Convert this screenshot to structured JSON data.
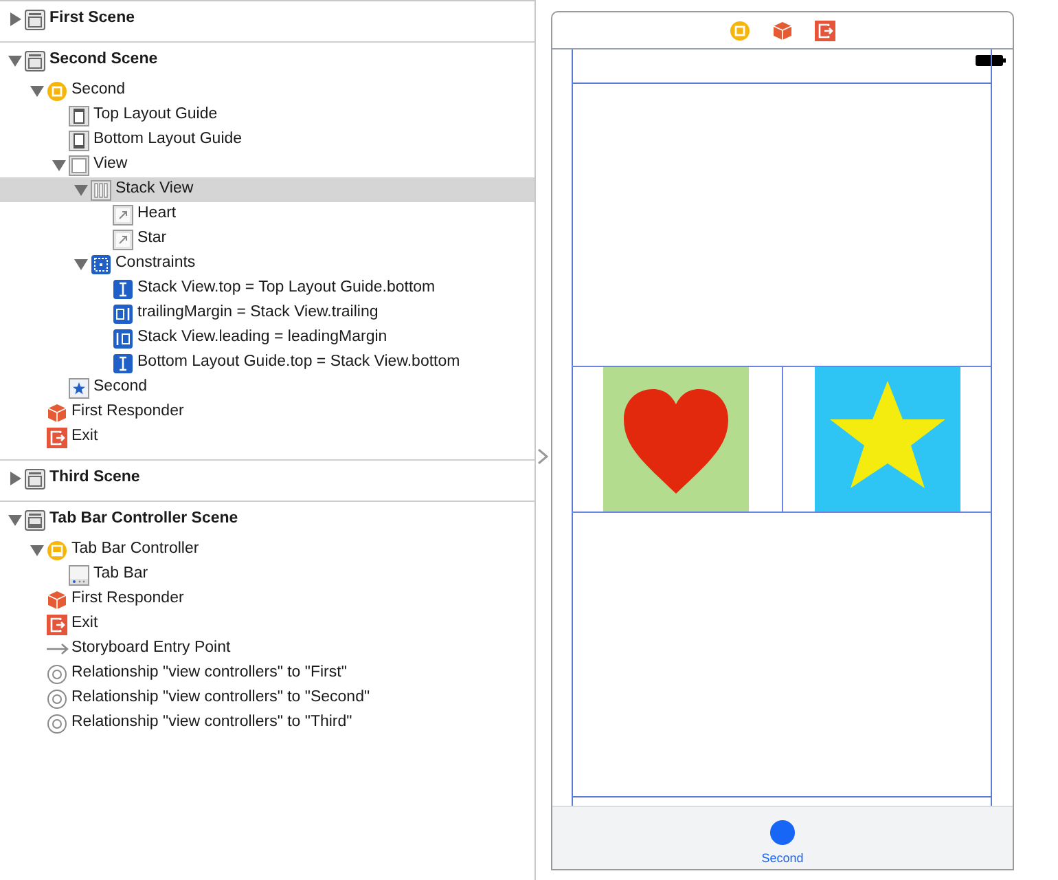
{
  "outline": {
    "scenes": [
      {
        "title": "First Scene",
        "kind": "scene",
        "expanded": false,
        "selected": false
      },
      {
        "title": "Second Scene",
        "kind": "scene",
        "expanded": true,
        "selected": false,
        "children": [
          {
            "label": "Second",
            "kind": "view_controller",
            "expanded": true,
            "selected": false,
            "children": [
              {
                "label": "Top Layout Guide",
                "kind": "top_guide",
                "selected": false
              },
              {
                "label": "Bottom Layout Guide",
                "kind": "bottom_guide",
                "selected": false
              },
              {
                "label": "View",
                "kind": "view",
                "expanded": true,
                "selected": false,
                "children": [
                  {
                    "label": "Stack View",
                    "kind": "stack_view",
                    "expanded": true,
                    "selected": true,
                    "children": [
                      {
                        "label": "Heart",
                        "kind": "image_view",
                        "selected": false
                      },
                      {
                        "label": "Star",
                        "kind": "image_view",
                        "selected": false
                      }
                    ]
                  },
                  {
                    "label": "Constraints",
                    "kind": "constraints",
                    "expanded": true,
                    "selected": false,
                    "children": [
                      {
                        "label": "Stack View.top = Top Layout Guide.bottom",
                        "kind": "vertical_constraint",
                        "selected": false
                      },
                      {
                        "label": "trailingMargin = Stack View.trailing",
                        "kind": "trailing_constraint",
                        "selected": false
                      },
                      {
                        "label": "Stack View.leading = leadingMargin",
                        "kind": "leading_constraint",
                        "selected": false
                      },
                      {
                        "label": "Bottom Layout Guide.top = Stack View.bottom",
                        "kind": "vertical_constraint",
                        "selected": false
                      }
                    ]
                  }
                ]
              },
              {
                "label": "Second",
                "kind": "tab_bar_item",
                "selected": false
              }
            ]
          },
          {
            "label": "First Responder",
            "kind": "first_responder",
            "selected": false
          },
          {
            "label": "Exit",
            "kind": "exit",
            "selected": false
          }
        ]
      },
      {
        "title": "Third Scene",
        "kind": "scene",
        "expanded": false,
        "selected": false
      },
      {
        "title": "Tab Bar Controller Scene",
        "kind": "tab_scene",
        "expanded": true,
        "selected": false,
        "children": [
          {
            "label": "Tab Bar Controller",
            "kind": "tab_bar_controller",
            "expanded": true,
            "selected": false,
            "children": [
              {
                "label": "Tab Bar",
                "kind": "tab_bar",
                "selected": false
              }
            ]
          },
          {
            "label": "First Responder",
            "kind": "first_responder",
            "selected": false
          },
          {
            "label": "Exit",
            "kind": "exit",
            "selected": false
          },
          {
            "label": "Storyboard Entry Point",
            "kind": "entry_point",
            "selected": false
          },
          {
            "label": "Relationship \"view controllers\" to \"First\"",
            "kind": "relationship",
            "selected": false
          },
          {
            "label": "Relationship \"view controllers\" to \"Second\"",
            "kind": "relationship",
            "selected": false
          },
          {
            "label": "Relationship \"view controllers\" to \"Third\"",
            "kind": "relationship",
            "selected": false
          }
        ]
      }
    ]
  },
  "canvas": {
    "tab_bar": {
      "items": [
        {
          "label": "Second",
          "selected": true
        }
      ]
    }
  }
}
